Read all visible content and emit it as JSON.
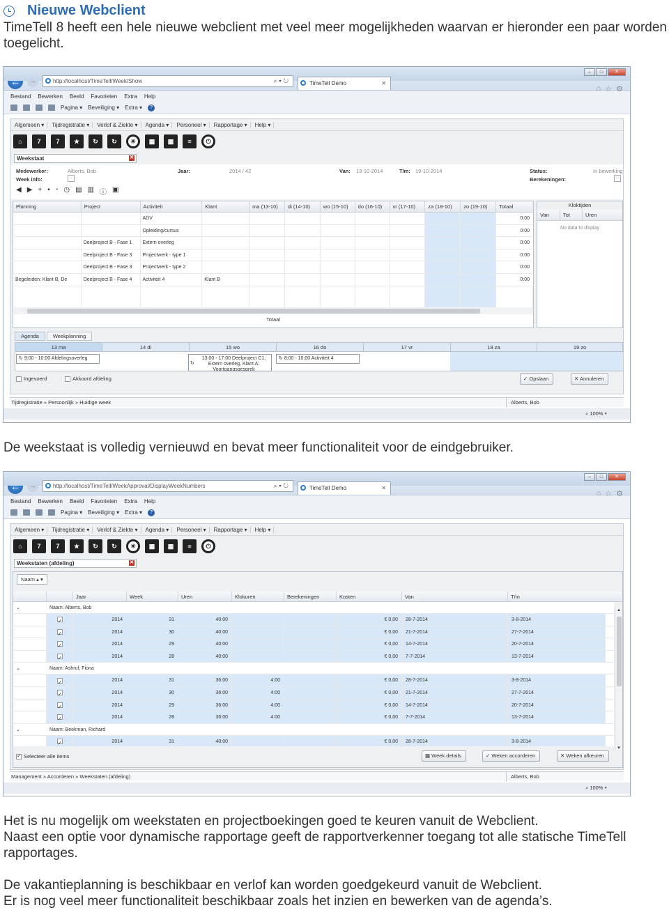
{
  "heading": {
    "title": "Nieuwe Webclient"
  },
  "intro": "TimeTell 8 heeft een hele nieuwe webclient met veel meer mogelijkheden waarvan er hieronder een paar worden toegelicht.",
  "caption1": "De weekstaat is volledig vernieuwd en bevat meer functionaliteit voor de eindgebruiker.",
  "para2_line1": "Het is nu mogelijk om weekstaten en projectboekingen goed te keuren vanuit de Webclient.",
  "para2_line2": "Naast een optie voor dynamische rapportage geeft de rapportverkenner toegang tot alle statische TimeTell rapportages.",
  "para3_line1": "De vakantieplanning is beschikbaar en verlof kan worden goedgekeurd vanuit de Webclient.",
  "para3_line2": "Er is nog veel meer functionaliteit beschikbaar zoals het inzien en bewerken van de agenda’s.",
  "browser": {
    "menu": [
      "Bestand",
      "Bewerken",
      "Beeld",
      "Favorieten",
      "Extra",
      "Help"
    ],
    "cmd": [
      "Pagina ▾",
      "Beveiliging ▾",
      "Extra ▾"
    ],
    "tab_title": "TimeTell Demo",
    "zoom": "100%"
  },
  "app_menu": [
    "Algemeen ▾",
    "Tijdregistratie ▾",
    "Verlof & Ziekte ▾",
    "Agenda ▾",
    "Personeel ▾",
    "Rapportage ▾",
    "Help ▾"
  ],
  "shot1": {
    "url": "http://localhost/TimeTell/Week/Show",
    "doctab": "Weekstaat",
    "info": {
      "medewerker_label": "Medewerker:",
      "medewerker": "Alberts, Bob",
      "weekinfo_label": "Week info:",
      "jaar_label": "Jaar:",
      "jaar": "2014 / 42",
      "van_label": "Van:",
      "van": "13-10-2014",
      "tm_label": "T/m:",
      "tm": "19-10-2014",
      "status_label": "Status:",
      "status": "In bewerking",
      "berek_label": "Berekeningen:"
    },
    "columns": [
      "Planning",
      "Project",
      "Activiteit",
      "Klant",
      "ma (13-10)",
      "di (14-10)",
      "wo (15-10)",
      "do (16-10)",
      "vr (17-10)",
      "za (18-10)",
      "zo (19-10)",
      "Totaal"
    ],
    "rows": [
      {
        "planning": "",
        "project": "",
        "activiteit": "ADV",
        "klant": "",
        "totaal": "0:00"
      },
      {
        "planning": "",
        "project": "",
        "activiteit": "Opleiding/cursus",
        "klant": "",
        "totaal": "0:00"
      },
      {
        "planning": "",
        "project": "Deelproject B - Fase 1",
        "activiteit": "Extern overleg",
        "klant": "",
        "totaal": "0:00"
      },
      {
        "planning": "",
        "project": "Deelproject B - Fase 3",
        "activiteit": "Projectwerk - type 1",
        "klant": "",
        "totaal": "0:00"
      },
      {
        "planning": "",
        "project": "Deelproject B - Fase 3",
        "activiteit": "Projectwerk - type 2",
        "klant": "",
        "totaal": "0:00"
      },
      {
        "planning": "Begeleiden: Klant B, De",
        "project": "Deelproject B - Fase 4",
        "activiteit": "Activiteit 4",
        "klant": "Klant B",
        "totaal": "0:00"
      }
    ],
    "totaal_label": "Totaal",
    "klok": {
      "title": "Kloktijden",
      "cols": [
        "Van",
        "Tot",
        "Uren"
      ],
      "empty": "No data to display"
    },
    "plan_tabs": [
      "Agenda",
      "Weekplanning"
    ],
    "days": [
      "13 ma",
      "14 di",
      "15 wo",
      "16 do",
      "17 vr",
      "18 za",
      "19 zo"
    ],
    "events": [
      "9:00 - 10:00 Afdelingsoverleg",
      "13:00 - 17:00 Deelproject C1, Extern overleg, Klant A: Voortgangsgesprek",
      "8:00 - 10:00 Activiteit 4"
    ],
    "ingevoerd": "Ingevoerd",
    "akkoord": "Akkoord afdeling",
    "opslaan": "Opslaan",
    "annuleren": "Annuleren",
    "breadcrumb": "Tijdregistratie » Persoonlijk » Huidige week",
    "user": "Alberts, Bob"
  },
  "shot2": {
    "url": "http://localhost/TimeTell/WeekApproval/DisplayWeekNumbers",
    "doctab": "Weekstaten (afdeling)",
    "group_chip": "Naam ▴ ▾",
    "columns": [
      "Jaar",
      "Week",
      "Uren",
      "Klokuren",
      "Berekeningen",
      "Kosten",
      "Van",
      "T/m"
    ],
    "groups": [
      {
        "name": "Naam: Alberts, Bob",
        "rows": [
          {
            "jaar": "2014",
            "week": "31",
            "uren": "40:00",
            "klok": "",
            "kosten": "€ 0,00",
            "van": "28-7-2014",
            "tm": "3-8-2014"
          },
          {
            "jaar": "2014",
            "week": "30",
            "uren": "40:00",
            "klok": "",
            "kosten": "€ 0,00",
            "van": "21-7-2014",
            "tm": "27-7-2014"
          },
          {
            "jaar": "2014",
            "week": "29",
            "uren": "40:00",
            "klok": "",
            "kosten": "€ 0,00",
            "van": "14-7-2014",
            "tm": "20-7-2014"
          },
          {
            "jaar": "2014",
            "week": "28",
            "uren": "40:00",
            "klok": "",
            "kosten": "€ 0,00",
            "van": "7-7-2014",
            "tm": "13-7-2014"
          }
        ]
      },
      {
        "name": "Naam: Ashruf, Fiona",
        "rows": [
          {
            "jaar": "2014",
            "week": "31",
            "uren": "36:00",
            "klok": "4:00",
            "kosten": "€ 0,00",
            "van": "28-7-2014",
            "tm": "3-8-2014"
          },
          {
            "jaar": "2014",
            "week": "30",
            "uren": "36:00",
            "klok": "4:00",
            "kosten": "€ 0,00",
            "van": "21-7-2014",
            "tm": "27-7-2014"
          },
          {
            "jaar": "2014",
            "week": "29",
            "uren": "36:00",
            "klok": "4:00",
            "kosten": "€ 0,00",
            "van": "14-7-2014",
            "tm": "20-7-2014"
          },
          {
            "jaar": "2014",
            "week": "28",
            "uren": "36:00",
            "klok": "4:00",
            "kosten": "€ 0,00",
            "van": "7-7-2014",
            "tm": "13-7-2014"
          }
        ]
      },
      {
        "name": "Naam: Beekman, Richard",
        "rows": [
          {
            "jaar": "2014",
            "week": "31",
            "uren": "40:00",
            "klok": "",
            "kosten": "€ 0,00",
            "van": "28-7-2014",
            "tm": "3-8-2014"
          }
        ]
      }
    ],
    "select_all": "Selecteer alle items",
    "week_details": "Week details",
    "accept": "Weken accorderen",
    "reject": "Weken afkeuren",
    "breadcrumb": "Management » Accorderen » Weekstaten (afdeling)",
    "user": "Alberts, Bob"
  }
}
